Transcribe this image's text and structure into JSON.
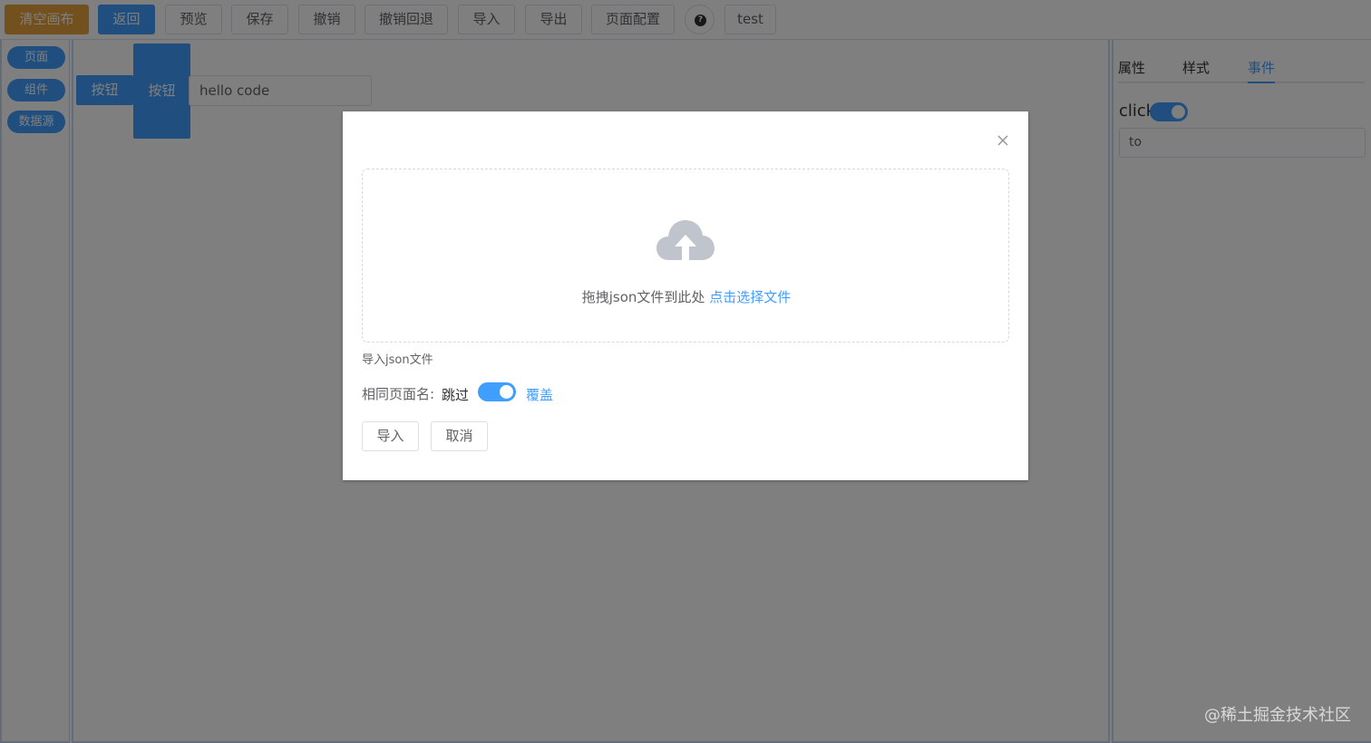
{
  "toolbar": {
    "clear_label": "清空画布",
    "back_label": "返回",
    "preview_label": "预览",
    "save_label": "保存",
    "undo_label": "撤销",
    "redo_label": "撤销回退",
    "import_label": "导入",
    "export_label": "导出",
    "page_config_label": "页面配置",
    "help_glyph": "?",
    "test_label": "test"
  },
  "sidebar": {
    "items": [
      {
        "label": "页面"
      },
      {
        "label": "组件"
      },
      {
        "label": "数据源"
      }
    ]
  },
  "canvas": {
    "button_1": "按钮",
    "button_2": "按钮",
    "input_value": "hello code"
  },
  "right_panel": {
    "tabs": [
      {
        "label": "属性"
      },
      {
        "label": "样式"
      },
      {
        "label": "事件"
      }
    ],
    "event_label": "click",
    "event_on": true,
    "to_value": "to"
  },
  "dialog": {
    "close_glyph": "×",
    "upload_text": "拖拽json文件到此处 ",
    "upload_link": "点击选择文件",
    "tip": "导入json文件",
    "same_name_label": "相同页面名:",
    "skip_label": "跳过",
    "cover_label": "覆盖",
    "cover_on": true,
    "import_button": "导入",
    "cancel_button": "取消"
  },
  "watermark": "@稀土掘金技术社区",
  "colors": {
    "primary": "#409eff",
    "warning": "#e6a23c",
    "overlay": "rgba(0,0,0,0.5)"
  }
}
